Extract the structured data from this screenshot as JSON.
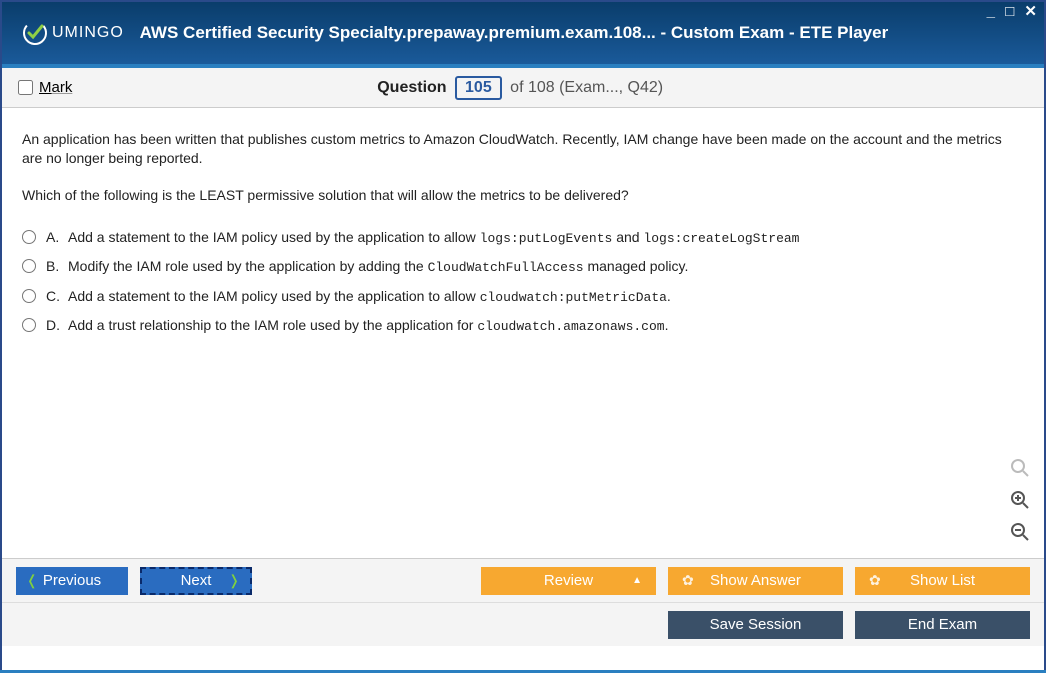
{
  "window": {
    "title": "AWS Certified Security Specialty.prepaway.premium.exam.108... - Custom Exam - ETE Player",
    "logo_text": "UMINGO"
  },
  "subheader": {
    "mark_label": "Mark",
    "question_label": "Question",
    "current": "105",
    "total_suffix": "of 108 (Exam..., Q42)"
  },
  "question": {
    "paragraph1": "An application has been written that publishes custom metrics to Amazon CloudWatch. Recently, IAM change have been made on the account and the metrics are no longer being reported.",
    "paragraph2": "Which of the following is the LEAST permissive solution that will allow the metrics to be delivered?",
    "answers": [
      {
        "letter": "A.",
        "html": "Add a statement to the IAM policy used by the application to allow <code>logs:putLogEvents</code> and <code>logs:createLogStream</code>"
      },
      {
        "letter": "B.",
        "html": "Modify the IAM role used by the application by adding the <code>CloudWatchFullAccess</code> managed policy."
      },
      {
        "letter": "C.",
        "html": "Add a statement to the IAM policy used by the application to allow <code>cloudwatch:putMetricData</code>."
      },
      {
        "letter": "D.",
        "html": "Add a trust relationship to the IAM role used by the application for <code>cloudwatch.amazonaws.com</code>."
      }
    ]
  },
  "footer": {
    "previous": "Previous",
    "next": "Next",
    "review": "Review",
    "show_answer": "Show Answer",
    "show_list": "Show List",
    "save_session": "Save Session",
    "end_exam": "End Exam"
  }
}
